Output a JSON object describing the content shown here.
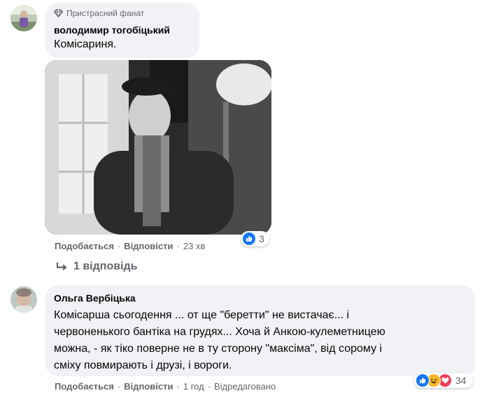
{
  "comment1": {
    "badge": "Пристрасний фанат",
    "author": "володимир тогобіцький",
    "text": "Комісариня.",
    "reaction_count": "3",
    "actions": {
      "like": "Подобається",
      "reply": "Відповісти",
      "time": "23 хв"
    },
    "replies_link": "1 відповідь"
  },
  "comment2": {
    "author": "Ольга Вербіцька",
    "text_lines": [
      "Комісарша сьогодення ... от ще \"беретти\" не вистачає... і",
      "червоненького бантіка на грудях... Хоча й Анкою-кулеметницею",
      "можна, - як тіко поверне не в ту сторону \"максіма\", від сорому і",
      "сміху повмирають і друзі, і вороги."
    ],
    "reaction_count": "34",
    "actions": {
      "like": "Подобається",
      "reply": "Відповісти",
      "time": "1 год",
      "edited": "Відредаговано"
    }
  },
  "colors": {
    "like_blue": "#1877f2",
    "haha_yellow": "#f7b928",
    "love_red": "#f33e58",
    "bubble_gray": "#f0f2f5",
    "meta_gray": "#65676b"
  },
  "icons": [
    "diamond-icon",
    "reply-arrow-icon",
    "like-reaction-icon",
    "haha-reaction-icon",
    "love-reaction-icon"
  ]
}
